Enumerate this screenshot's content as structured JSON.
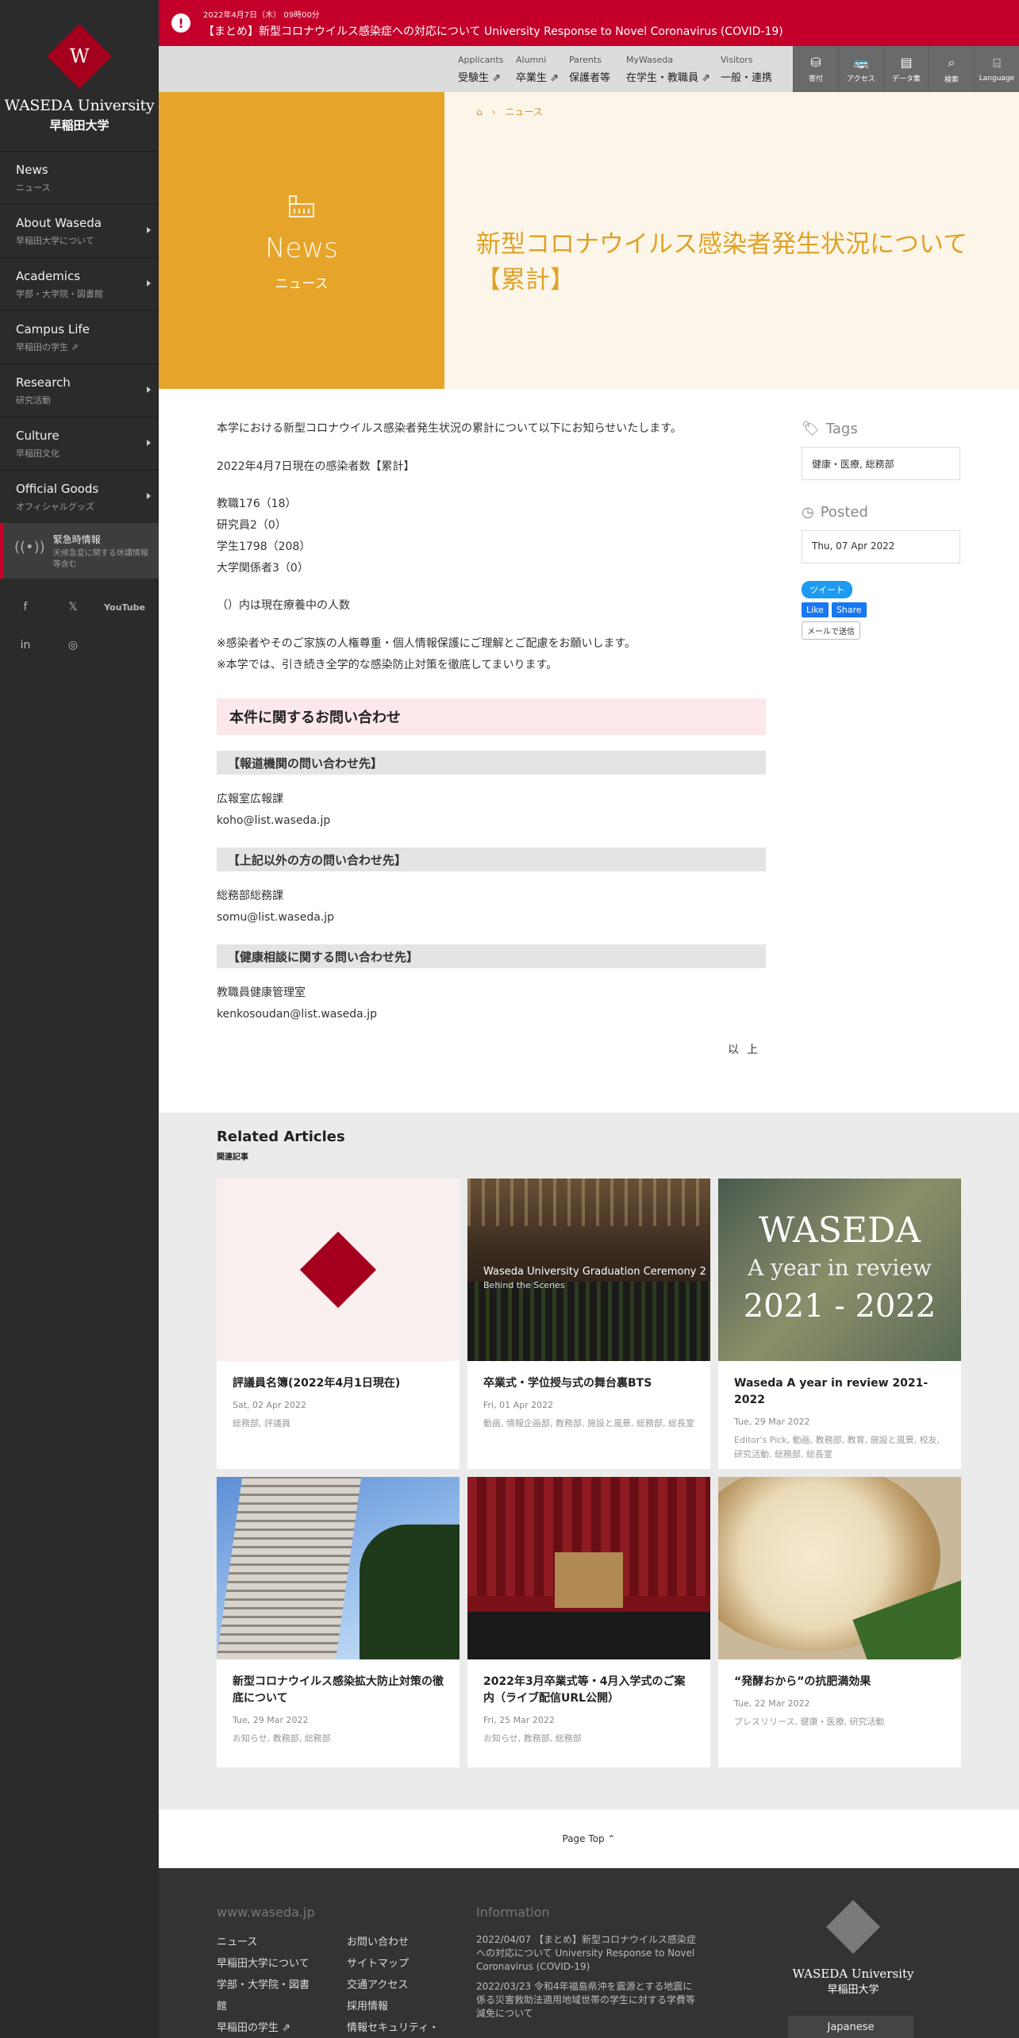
{
  "sidebar": {
    "logo_en": "WASEDA University",
    "logo_ja": "早稲田大学",
    "nav": [
      {
        "en": "News",
        "ja": "ニュース",
        "caret": false
      },
      {
        "en": "About Waseda",
        "ja": "早稲田大学について",
        "caret": true
      },
      {
        "en": "Academics",
        "ja": "学部・大学院・図書館",
        "caret": true
      },
      {
        "en": "Campus Life",
        "ja": "早稲田の学生 ⇗",
        "caret": false
      },
      {
        "en": "Research",
        "ja": "研究活動",
        "caret": true
      },
      {
        "en": "Culture",
        "ja": "早稲田文化",
        "caret": true
      },
      {
        "en": "Official Goods",
        "ja": "オフィシャルグッズ",
        "caret": true
      }
    ],
    "emergency_title": "緊急時情報",
    "emergency_sub": "天候急変に関する休講情報等含む",
    "social_labels": [
      "f",
      "𝕏",
      "YouTube",
      "in",
      "◎"
    ]
  },
  "alert": {
    "date": "2022年4月7日（木） 09時00分",
    "title": "【まとめ】新型コロナウイルス感染症への対応について University Response to Novel Coronavirus (COVID-19)"
  },
  "topnav": {
    "audiences": [
      {
        "en": "Applicants",
        "ja": "受験生 ⇗"
      },
      {
        "en": "Alumni",
        "ja": "卒業生 ⇗"
      },
      {
        "en": "Parents",
        "ja": "保護者等"
      },
      {
        "en": "MyWaseda",
        "ja": "在学生・教職員 ⇗"
      },
      {
        "en": "Visitors",
        "ja": "一般・連携"
      }
    ],
    "tools": [
      {
        "icon": "⛁",
        "label": "寄付"
      },
      {
        "icon": "🚌",
        "label": "アクセス"
      },
      {
        "icon": "▤",
        "label": "データ集"
      },
      {
        "icon": "⌕",
        "label": "検索"
      },
      {
        "icon": "⌸",
        "label": "Language"
      }
    ]
  },
  "hero": {
    "section_en": "News",
    "section_ja": "ニュース",
    "breadcrumb_home": "⌂",
    "breadcrumb_sep": "›",
    "breadcrumb_current": "ニュース",
    "title": "新型コロナウイルス感染者発生状況について【累計】"
  },
  "article": {
    "intro": "本学における新型コロナウイルス感染者発生状況の累計について以下にお知らせいたします。",
    "as_of": "2022年4月7日現在の感染者数【累計】",
    "counts": [
      "教職176（18）",
      "研究員2（0）",
      "学生1798（208）",
      "大学関係者3（0）"
    ],
    "note": "（）内は現在療養中の人数",
    "request_1": "※感染者やそのご家族の人権尊重・個人情報保護にご理解とご配慮をお願いします。",
    "request_2": "※本学では、引き続き全学的な感染防止対策を徹底してまいります。",
    "contact_heading": "本件に関するお問い合わせ",
    "contacts": [
      {
        "heading": "【報道機関の問い合わせ先】",
        "dept": "広報室広報課",
        "email": "koho@list.waseda.jp"
      },
      {
        "heading": "【上記以外の方の問い合わせ先】",
        "dept": "総務部総務課",
        "email": "somu@list.waseda.jp"
      },
      {
        "heading": "【健康相談に関する問い合わせ先】",
        "dept": "教職員健康管理室",
        "email": "kenkosoudan@list.waseda.jp"
      }
    ],
    "closing": "以上"
  },
  "aside": {
    "tags_heading": "Tags",
    "tags_value": "健康・医療, 総務部",
    "posted_heading": "Posted",
    "posted_value": "Thu, 07 Apr 2022",
    "tweet_label": "ツイート",
    "like_label": "Like",
    "share_label": "Share",
    "mail_label": "メールで送信"
  },
  "related": {
    "title": "Related Articles",
    "subtitle": "関連記事",
    "cards": [
      {
        "title": "評議員名簿(2022年4月1日現在)",
        "date": "Sat, 02 Apr 2022",
        "tags": "総務部, 評議員",
        "image": "diamond"
      },
      {
        "title": "卒業式・学位授与式の舞台裏BTS",
        "date": "Fri, 01 Apr 2022",
        "tags": "動画, 情報企画部, 教務部, 施設と風景, 総務部, 総長室",
        "image": "ceremony",
        "image_caption": "Waseda University Graduation Ceremony 2",
        "image_caption_sub": "Behind the Scenes"
      },
      {
        "title": "Waseda A year in review 2021-2022",
        "date": "Tue, 29 Mar 2022",
        "tags": "Editor's Pick, 動画, 教務部, 教育, 施設と風景, 校友, 研究活動, 総務部, 総長室",
        "image": "review",
        "image_line1": "WASEDA",
        "image_line2": "A year in review",
        "image_line3": "2021 - 2022"
      },
      {
        "title": "新型コロナウイルス感染拡大防止対策の徹底について",
        "date": "Tue, 29 Mar 2022",
        "tags": "お知らせ, 教務部, 総務部",
        "image": "building"
      },
      {
        "title": "2022年3月卒業式等・4月入学式のご案内（ライブ配信URL公開）",
        "date": "Fri, 25 Mar 2022",
        "tags": "お知らせ, 教務部, 総務部",
        "image": "stage"
      },
      {
        "title": "“発酵おから”の抗肥満効果",
        "date": "Tue, 22 Mar 2022",
        "tags": "プレスリリース, 健康・医療, 研究活動",
        "image": "okara"
      }
    ]
  },
  "pagetop": "Page Top ⌃",
  "footer": {
    "site_heading": "www.waseda.jp",
    "col1": [
      "ニュース",
      "早稲田大学について",
      "学部・大学院・図書",
      "館",
      "早稲田の学生 ⇗"
    ],
    "col2": [
      "お問い合わせ",
      "サイトマップ",
      "交通アクセス",
      "採用情報",
      "情報セキュリティ・"
    ],
    "info_heading": "Information",
    "info_items": [
      "2022/04/07 【まとめ】新型コロナウイルス感染症への対応について University Response to Novel Coronavirus (COVID-19)",
      "2022/03/23 令和4年福島県沖を震源とする地震に係る災害救助法適用地域世帯の学生に対する学費等減免について"
    ],
    "logo_en": "WASEDA University",
    "logo_ja": "早稲田大学",
    "language_button": "Japanese"
  },
  "colors": {
    "accent_red": "#c4002a",
    "waseda_crimson": "#a4001e",
    "news_gold": "#e6a52a",
    "title_gold": "#e0a227",
    "hero_cream": "#fcf6ea",
    "sidebar_dark": "#2b2b2b"
  }
}
